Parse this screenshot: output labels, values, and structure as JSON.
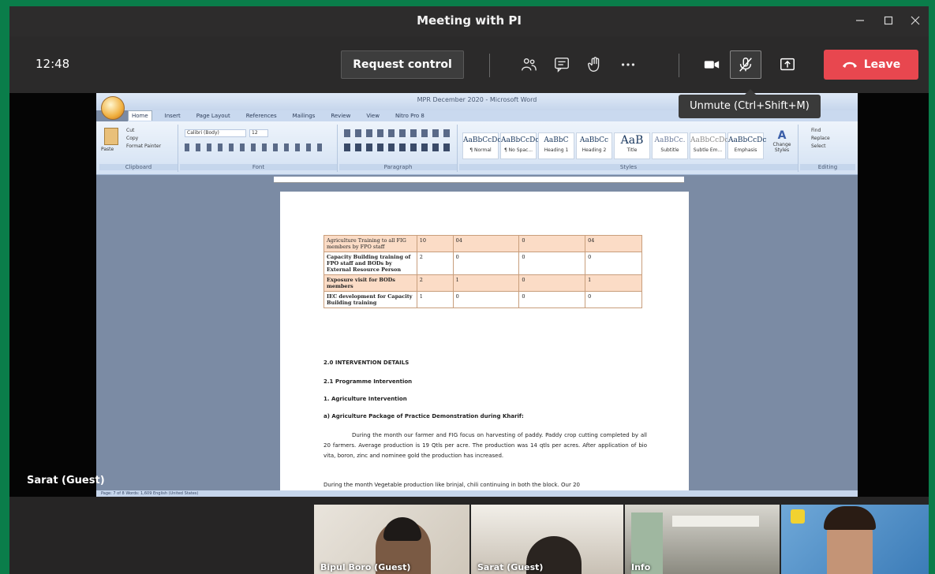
{
  "window": {
    "title": "Meeting with PI"
  },
  "toolbar": {
    "clock": "12:48",
    "request_control_label": "Request control",
    "leave_label": "Leave",
    "leave_color": "#e8474f"
  },
  "tooltip": {
    "text": "Unmute (Ctrl+Shift+M)"
  },
  "presenter": {
    "name": "Sarat (Guest)"
  },
  "word": {
    "title": "MPR December 2020 - Microsoft Word",
    "tabs": [
      "Home",
      "Insert",
      "Page Layout",
      "References",
      "Mailings",
      "Review",
      "View",
      "Nitro Pro 8"
    ],
    "groups": [
      "Clipboard",
      "Font",
      "Paragraph",
      "Styles",
      "Editing"
    ],
    "font_name": "Calibri (Body)",
    "font_size": "12",
    "clipboard_items": [
      "Paste",
      "Cut",
      "Copy",
      "Format Painter"
    ],
    "styles": [
      {
        "sample": "AaBbCcDc",
        "name": "¶ Normal"
      },
      {
        "sample": "AaBbCcDc",
        "name": "¶ No Spac..."
      },
      {
        "sample": "AaBbC",
        "name": "Heading 1"
      },
      {
        "sample": "AaBbCc",
        "name": "Heading 2"
      },
      {
        "sample": "AaB",
        "name": "Title"
      },
      {
        "sample": "AaBbCc.",
        "name": "Subtitle"
      },
      {
        "sample": "AaBbCcDc",
        "name": "Subtle Em..."
      },
      {
        "sample": "AaBbCcDc",
        "name": "Emphasis"
      }
    ],
    "change_styles": "Change Styles",
    "editing_items": [
      "Find",
      "Replace",
      "Select"
    ],
    "status": "Page: 7 of 8   Words: 1,609   English (United States)"
  },
  "document": {
    "table": [
      {
        "shaded": true,
        "cells": [
          "Agriculture Training to all FIG members by FPO staff",
          "10",
          "04",
          "0",
          "04"
        ]
      },
      {
        "shaded": false,
        "cells": [
          "Capacity Building training of FPO staff and BODs by External Resource Person",
          "2",
          "0",
          "0",
          "0"
        ]
      },
      {
        "shaded": true,
        "cells": [
          "Exposure visit for BODs members",
          "2",
          "1",
          "0",
          "1"
        ]
      },
      {
        "shaded": false,
        "cells": [
          "IEC development for Capacity Building training",
          "1",
          "0",
          "0",
          "0"
        ]
      }
    ],
    "h1": "2.0 INTERVENTION DETAILS",
    "h2": "2.1 Programme Intervention",
    "h3": "1. Agriculture Intervention",
    "h4": "a) Agriculture Package of Practice Demonstration during Kharif:",
    "para1": "During the month our farmer and FIG focus on harvesting of paddy. Paddy crop cutting completed by all 20 farmers. Average production is 19 Qtls per acre. The production was 14 qtls per acres. After application of bio vita, boron, zinc and nominee gold the production has increased.",
    "para2": "During the month Vegetable production like brinjal, chili continuing in both the block. Our 20"
  },
  "gallery": {
    "tiles": [
      {
        "name": "Bipul Boro (Guest)"
      },
      {
        "name": "Sarat (Guest)"
      },
      {
        "name": "Info"
      },
      {
        "name": ""
      }
    ]
  }
}
